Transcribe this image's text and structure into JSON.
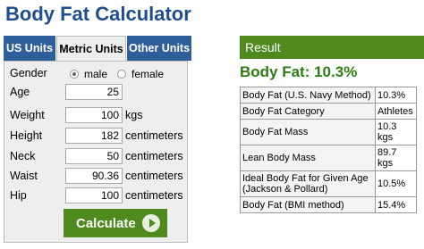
{
  "page_title": "Body Fat Calculator",
  "tabs": [
    {
      "label": "US Units",
      "active": false
    },
    {
      "label": "Metric Units",
      "active": true
    },
    {
      "label": "Other Units",
      "active": false
    }
  ],
  "form": {
    "gender_label": "Gender",
    "gender_options": [
      {
        "label": "male",
        "selected": true
      },
      {
        "label": "female",
        "selected": false
      }
    ],
    "fields": [
      {
        "label": "Age",
        "value": "25",
        "unit": ""
      },
      {
        "label": "Weight",
        "value": "100",
        "unit": "kgs"
      },
      {
        "label": "Height",
        "value": "182",
        "unit": "centimeters"
      },
      {
        "label": "Neck",
        "value": "50",
        "unit": "centimeters"
      },
      {
        "label": "Waist",
        "value": "90.36",
        "unit": "centimeters"
      },
      {
        "label": "Hip",
        "value": "100",
        "unit": "centimeters"
      }
    ],
    "calculate_label": "Calculate"
  },
  "result": {
    "header": "Result",
    "headline": "Body Fat: 10.3%",
    "rows": [
      {
        "label": "Body Fat (U.S. Navy Method)",
        "value": "10.3%"
      },
      {
        "label": "Body Fat Category",
        "value": "Athletes"
      },
      {
        "label": "Body Fat Mass",
        "value": "10.3 kgs"
      },
      {
        "label": "Lean Body Mass",
        "value": "89.7 kgs"
      },
      {
        "label": "Ideal Body Fat for Given Age (Jackson & Pollard)",
        "value": "10.5%"
      },
      {
        "label": "Body Fat (BMI method)",
        "value": "15.4%"
      }
    ]
  },
  "colors": {
    "title": "#1f4e8c",
    "tab_inactive": "#2f5f9a",
    "accent_green": "#4f8a1f",
    "headline_green": "#2e7d12"
  },
  "icons": {
    "calculate": "play-circle-icon"
  }
}
